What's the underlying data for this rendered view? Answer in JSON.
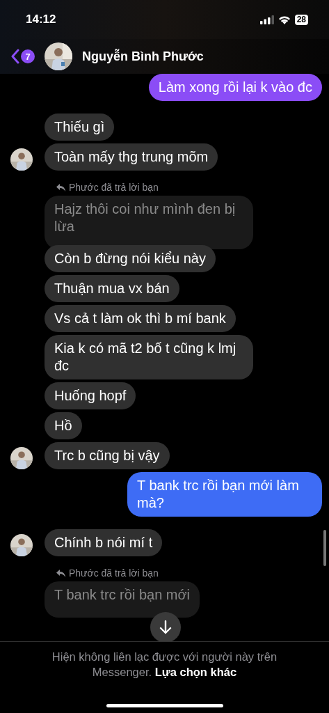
{
  "status_bar": {
    "time": "14:12",
    "battery": "28"
  },
  "header": {
    "unread_badge": "7",
    "contact_name": "Nguyễn Bình Phước"
  },
  "messages": [
    {
      "kind": "outgoing",
      "text": "Làm xong rồi lại k vào đc",
      "color": "#8b4df6"
    },
    {
      "kind": "incoming",
      "text": "Thiếu  gì"
    },
    {
      "kind": "incoming",
      "text": "Toàn mấy thg trung mõm"
    },
    {
      "kind": "reply_label",
      "text": "Phước đã trả lời bạn"
    },
    {
      "kind": "quoted",
      "text": "Hajz thôi coi như mình đen bị lừa"
    },
    {
      "kind": "incoming",
      "text": "Còn b đừng nói kiểu này"
    },
    {
      "kind": "incoming",
      "text": "Thuận mua vx bán"
    },
    {
      "kind": "incoming",
      "text": "Vs cả t làm ok thì b mí bank"
    },
    {
      "kind": "incoming",
      "text": "Kia k có mã t2 bố t cũng k lmj đc"
    },
    {
      "kind": "incoming",
      "text": "Huống hopf"
    },
    {
      "kind": "incoming",
      "text": "Hồ"
    },
    {
      "kind": "incoming",
      "text": "Trc b cũng bị vậy"
    },
    {
      "kind": "outgoing",
      "text": "T bank trc rồi bạn mới làm mà?",
      "color": "#3e6cf5"
    },
    {
      "kind": "incoming",
      "text": "Chính b nói mí t"
    },
    {
      "kind": "reply_label",
      "text": "Phước đã trả lời bạn"
    },
    {
      "kind": "quoted",
      "text": "T bank trc rồi bạn mới"
    }
  ],
  "footer": {
    "notice": "Hiện không liên lạc được với người này trên Messenger.",
    "link": "Lựa chọn khác"
  }
}
